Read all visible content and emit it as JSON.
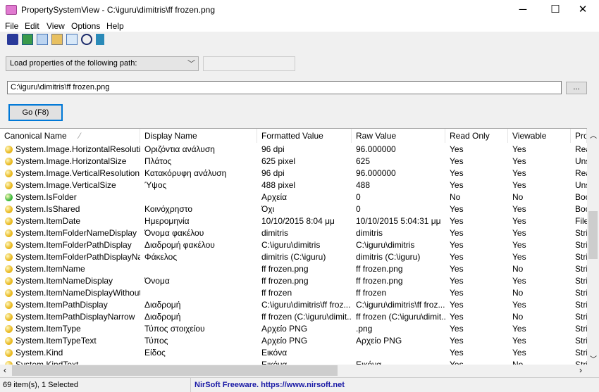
{
  "window": {
    "title": "PropertySystemView  -   C:\\iguru\\dimitris\\ff frozen.png",
    "minimize": "─",
    "maximize": "☐",
    "close": "✕"
  },
  "menu": [
    "File",
    "Edit",
    "View",
    "Options",
    "Help"
  ],
  "toolbar": [
    "save-icon",
    "refresh-icon",
    "copy-icon",
    "properties-icon",
    "find-icon",
    "options-icon",
    "exit-icon"
  ],
  "mode_combo": "Load properties of the following path:",
  "path_input": "C:\\iguru\\dimitris\\ff frozen.png",
  "browse_button": "...",
  "go_button": "Go (F8)",
  "columns": [
    "Canonical Name",
    "Display Name",
    "Formatted Value",
    "Raw Value",
    "Read Only",
    "Viewable",
    "Pro"
  ],
  "sort_indicator": "⁄",
  "rows": [
    [
      "System.Image.HorizontalResolution",
      "Οριζόντια ανάλυση",
      "96 dpi",
      "96.000000",
      "Yes",
      "Yes",
      "Rea",
      "yellow"
    ],
    [
      "System.Image.HorizontalSize",
      "Πλάτος",
      "625 pixel",
      "625",
      "Yes",
      "Yes",
      "Uns",
      "yellow"
    ],
    [
      "System.Image.VerticalResolution",
      "Κατακόρυφη ανάλυση",
      "96 dpi",
      "96.000000",
      "Yes",
      "Yes",
      "Rea",
      "yellow"
    ],
    [
      "System.Image.VerticalSize",
      "Ύψος",
      "488 pixel",
      "488",
      "Yes",
      "Yes",
      "Uns",
      "yellow"
    ],
    [
      "System.IsFolder",
      "",
      "Αρχεία",
      "0",
      "No",
      "No",
      "Boo",
      "green"
    ],
    [
      "System.IsShared",
      "Κοινόχρηστο",
      "Όχι",
      "0",
      "Yes",
      "Yes",
      "Boo",
      "yellow"
    ],
    [
      "System.ItemDate",
      "Ημερομηνία",
      "10/10/2015 8:04 μμ",
      "10/10/2015 5:04:31 μμ",
      "Yes",
      "Yes",
      "File",
      "yellow"
    ],
    [
      "System.ItemFolderNameDisplay",
      "Όνομα φακέλου",
      "dimitris",
      "dimitris",
      "Yes",
      "Yes",
      "Stri",
      "yellow"
    ],
    [
      "System.ItemFolderPathDisplay",
      "Διαδρομή φακέλου",
      "C:\\iguru\\dimitris",
      "C:\\iguru\\dimitris",
      "Yes",
      "Yes",
      "Stri",
      "yellow"
    ],
    [
      "System.ItemFolderPathDisplayNarrow",
      "Φάκελος",
      "dimitris (C:\\iguru)",
      "dimitris (C:\\iguru)",
      "Yes",
      "Yes",
      "Stri",
      "yellow"
    ],
    [
      "System.ItemName",
      "",
      "ff frozen.png",
      "ff frozen.png",
      "Yes",
      "No",
      "Stri",
      "yellow"
    ],
    [
      "System.ItemNameDisplay",
      "Όνομα",
      "ff frozen.png",
      "ff frozen.png",
      "Yes",
      "Yes",
      "Stri",
      "yellow"
    ],
    [
      "System.ItemNameDisplayWithoutEx...",
      "",
      "ff frozen",
      "ff frozen",
      "Yes",
      "No",
      "Stri",
      "yellow"
    ],
    [
      "System.ItemPathDisplay",
      "Διαδρομή",
      "C:\\iguru\\dimitris\\ff froz...",
      "C:\\iguru\\dimitris\\ff froz...",
      "Yes",
      "Yes",
      "Stri",
      "yellow"
    ],
    [
      "System.ItemPathDisplayNarrow",
      "Διαδρομή",
      "ff frozen (C:\\iguru\\dimit...",
      "ff frozen (C:\\iguru\\dimit...",
      "Yes",
      "No",
      "Stri",
      "yellow"
    ],
    [
      "System.ItemType",
      "Τύπος στοιχείου",
      "Αρχείο PNG",
      ".png",
      "Yes",
      "Yes",
      "Stri",
      "yellow"
    ],
    [
      "System.ItemTypeText",
      "Τύπος",
      "Αρχείο PNG",
      "Αρχείο PNG",
      "Yes",
      "Yes",
      "Stri",
      "yellow"
    ],
    [
      "System.Kind",
      "Είδος",
      "Εικόνα",
      "",
      "Yes",
      "Yes",
      "Stri",
      "yellow"
    ],
    [
      "System.KindText",
      "",
      "Εικόνα",
      "Εικόνα",
      "Yes",
      "No",
      "Stri",
      "yellow"
    ]
  ],
  "status": {
    "count": "69 item(s), 1 Selected",
    "credit": "NirSoft Freeware. https://www.nirsoft.net"
  },
  "colors": {
    "yellow": "#e8b820",
    "green": "#3cb83c",
    "link": "#1a1aa6",
    "focus": "#0078d7"
  }
}
